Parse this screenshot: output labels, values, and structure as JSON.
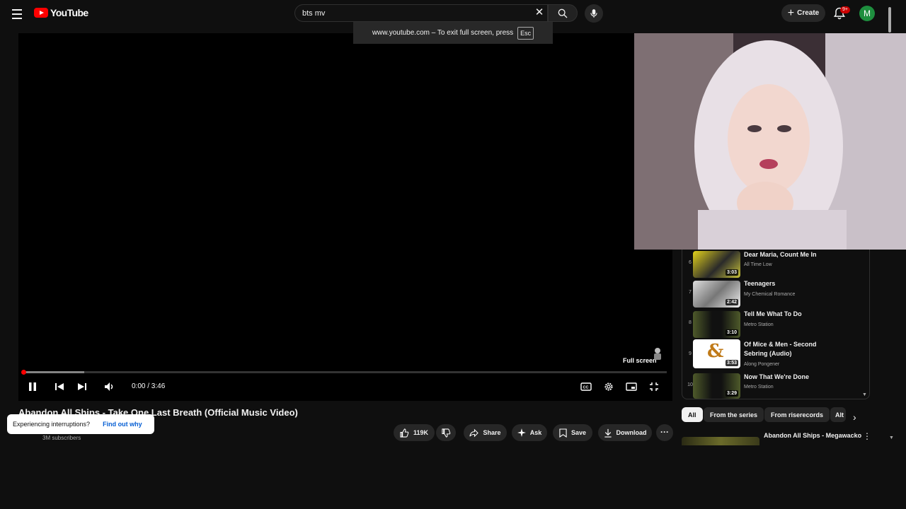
{
  "header": {
    "logo_text": "YouTube",
    "search_value": "bts mv",
    "create_label": "Create",
    "notification_badge": "9+",
    "avatar_initial": "M"
  },
  "fullscreen_tip": {
    "text": "www.youtube.com – To exit full screen, press",
    "key": "Esc"
  },
  "player": {
    "time": "0:00 / 3:46",
    "fullscreen_label": "Full screen",
    "progress_fraction": 0.0
  },
  "video": {
    "title": "Abandon All Ships - Take One Last Breath (Official Music Video)",
    "subscribers": "3M subscribers",
    "likes": "119K",
    "share_label": "Share",
    "ask_label": "Ask",
    "save_label": "Save",
    "download_label": "Download"
  },
  "interruption": {
    "text": "Experiencing interruptions?",
    "link": "Find out why"
  },
  "playlist": {
    "items": [
      {
        "index": "6",
        "title": "Dear Maria, Count Me In",
        "channel": "All Time Low",
        "duration": "3:03"
      },
      {
        "index": "7",
        "title": "Teenagers",
        "channel": "My Chemical Romance",
        "duration": "2:42"
      },
      {
        "index": "8",
        "title": "Tell Me What To Do",
        "channel": "Metro Station",
        "duration": "3:10"
      },
      {
        "index": "9",
        "title": "Of Mice & Men - Second Sebring (Audio)",
        "channel": "Along Pongener",
        "duration": "3:53"
      },
      {
        "index": "10",
        "title": "Now That We're Done",
        "channel": "Metro Station",
        "duration": "3:29"
      }
    ]
  },
  "chips": [
    "All",
    "From the series",
    "From riserecords",
    "Alt"
  ],
  "recommendation": {
    "title": "Abandon All Ships - Megawacko"
  },
  "colors": {
    "background": "#0f0f0f",
    "accent_red": "#ff0000",
    "chip_bg": "#272727",
    "link_blue": "#065fd4"
  }
}
